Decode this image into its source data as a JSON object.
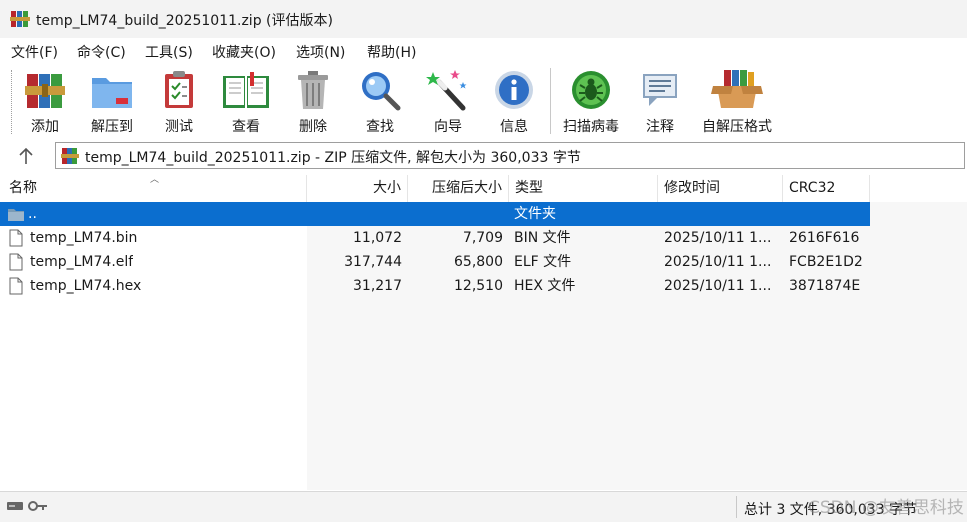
{
  "window": {
    "title": "temp_LM74_build_20251011.zip (评估版本)"
  },
  "menu": [
    {
      "label": "文件(F)"
    },
    {
      "label": "命令(C)"
    },
    {
      "label": "工具(S)"
    },
    {
      "label": "收藏夹(O)"
    },
    {
      "label": "选项(N)"
    },
    {
      "label": "帮助(H)"
    }
  ],
  "toolbar": [
    {
      "label": "添加",
      "icon": "winrar-books-icon"
    },
    {
      "label": "解压到",
      "icon": "folder-extract-icon"
    },
    {
      "label": "测试",
      "icon": "clipboard-check-icon"
    },
    {
      "label": "查看",
      "icon": "open-book-icon"
    },
    {
      "label": "删除",
      "icon": "trash-can-icon"
    },
    {
      "label": "查找",
      "icon": "magnifier-icon"
    },
    {
      "label": "向导",
      "icon": "magic-wand-icon"
    },
    {
      "label": "信息",
      "icon": "info-icon"
    },
    {
      "label": "扫描病毒",
      "icon": "virus-scan-icon"
    },
    {
      "label": "注释",
      "icon": "comment-icon"
    },
    {
      "label": "自解压格式",
      "icon": "sfx-box-icon"
    }
  ],
  "address": {
    "text": "temp_LM74_build_20251011.zip - ZIP 压缩文件, 解包大小为 360,033 字节"
  },
  "columns": {
    "name": "名称",
    "size": "大小",
    "packed": "压缩后大小",
    "type": "类型",
    "modified": "修改时间",
    "crc": "CRC32"
  },
  "rows": [
    {
      "name": "..",
      "size": "",
      "packed": "",
      "type": "文件夹",
      "modified": "",
      "crc": "",
      "selected": true
    },
    {
      "name": "temp_LM74.bin",
      "size": "11,072",
      "packed": "7,709",
      "type": "BIN 文件",
      "modified": "2025/10/11 1...",
      "crc": "2616F616"
    },
    {
      "name": "temp_LM74.elf",
      "size": "317,744",
      "packed": "65,800",
      "type": "ELF 文件",
      "modified": "2025/10/11 1...",
      "crc": "FCB2E1D2"
    },
    {
      "name": "temp_LM74.hex",
      "size": "31,217",
      "packed": "12,510",
      "type": "HEX 文件",
      "modified": "2025/10/11 1...",
      "crc": "3871874E"
    }
  ],
  "status": {
    "total": "总计 3 文件, 360,033 字节"
  },
  "watermark": "CSDN @友善思科技",
  "colors": {
    "selection": "#0b6ecf",
    "folder": "#7a9bb5"
  }
}
